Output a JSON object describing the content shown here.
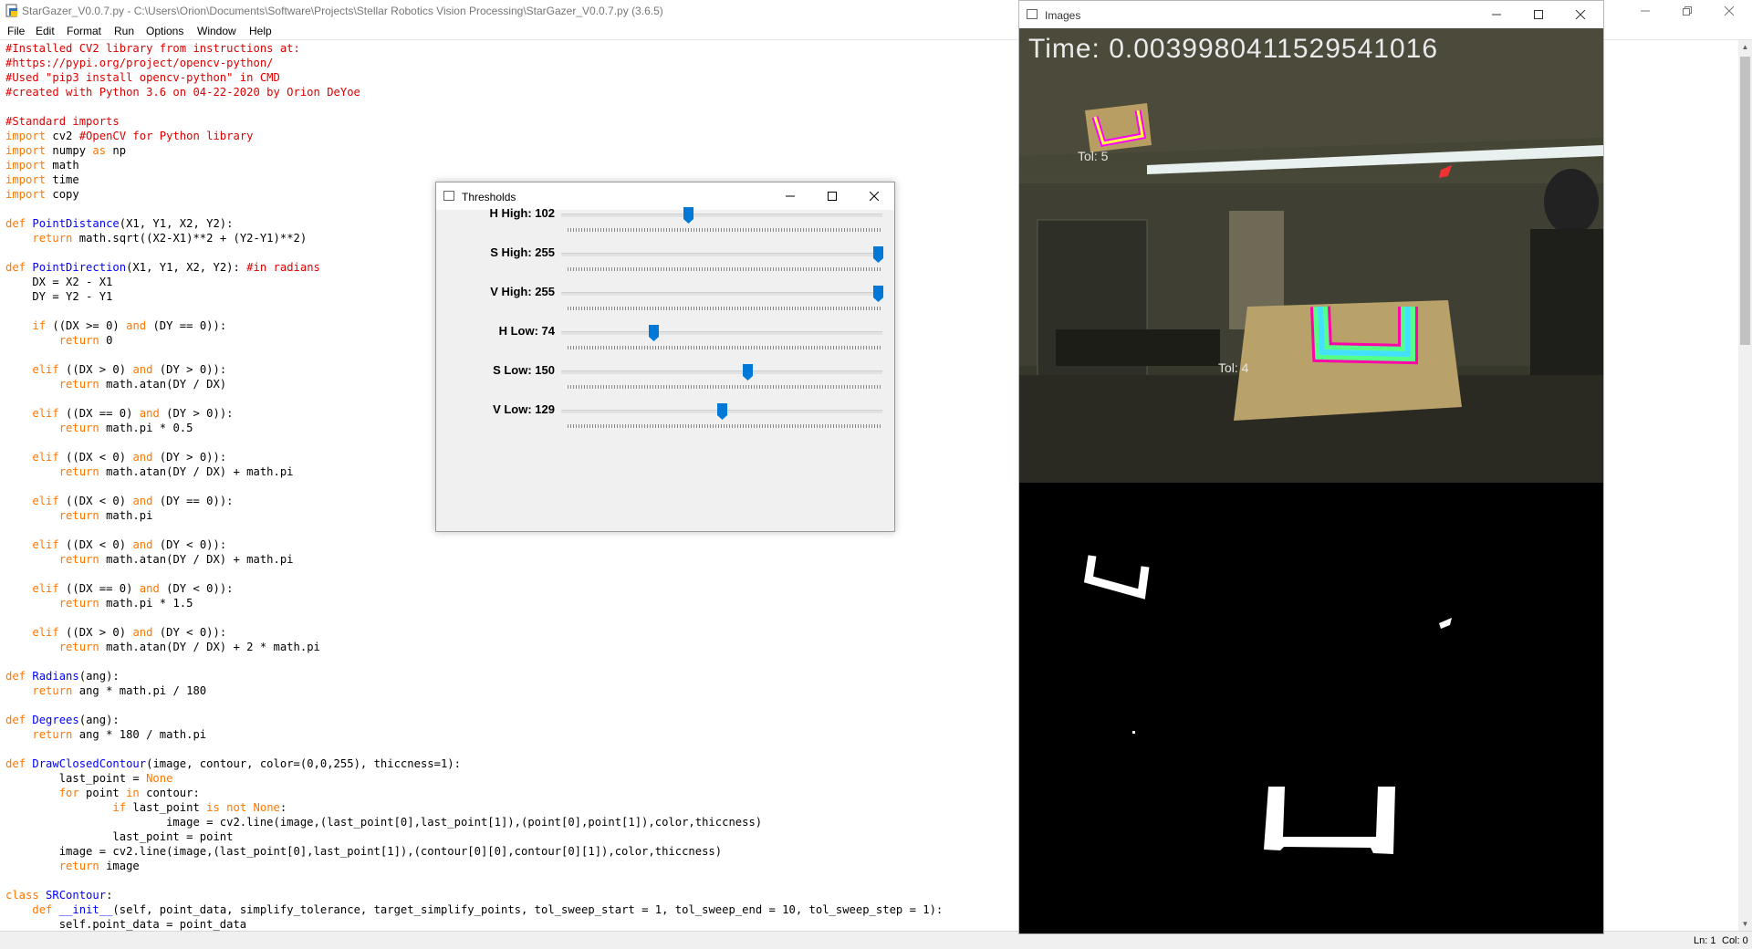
{
  "idle": {
    "title": "StarGazer_V0.0.7.py - C:\\Users\\Orion\\Documents\\Software\\Projects\\Stellar Robotics Vision Processing\\StarGazer_V0.0.7.py (3.6.5)",
    "menu": [
      "File",
      "Edit",
      "Format",
      "Run",
      "Options",
      "Window",
      "Help"
    ],
    "status": {
      "line": "Ln: 1",
      "col": "Col: 0"
    },
    "code": [
      [
        [
          "c",
          "#Installed CV2 library from instructions at:"
        ]
      ],
      [
        [
          "c",
          "#https://pypi.org/project/opencv-python/"
        ]
      ],
      [
        [
          "c",
          "#Used \"pip3 install opencv-python\" in CMD"
        ]
      ],
      [
        [
          "c",
          "#created with Python 3.6 on 04-22-2020 by Orion DeYoe"
        ]
      ],
      [],
      [
        [
          "c",
          "#Standard imports"
        ]
      ],
      [
        [
          "k",
          "import"
        ],
        [
          "t",
          " cv2 "
        ],
        [
          "c",
          "#OpenCV for Python library"
        ]
      ],
      [
        [
          "k",
          "import"
        ],
        [
          "t",
          " numpy "
        ],
        [
          "k",
          "as"
        ],
        [
          "t",
          " np"
        ]
      ],
      [
        [
          "k",
          "import"
        ],
        [
          "t",
          " math"
        ]
      ],
      [
        [
          "k",
          "import"
        ],
        [
          "t",
          " time"
        ]
      ],
      [
        [
          "k",
          "import"
        ],
        [
          "t",
          " copy"
        ]
      ],
      [],
      [
        [
          "k",
          "def"
        ],
        [
          "t",
          " "
        ],
        [
          "d",
          "PointDistance"
        ],
        [
          "t",
          "(X1, Y1, X2, Y2):"
        ]
      ],
      [
        [
          "t",
          "    "
        ],
        [
          "k",
          "return"
        ],
        [
          "t",
          " math.sqrt((X2-X1)**2 + (Y2-Y1)**2)"
        ]
      ],
      [],
      [
        [
          "k",
          "def"
        ],
        [
          "t",
          " "
        ],
        [
          "d",
          "PointDirection"
        ],
        [
          "t",
          "(X1, Y1, X2, Y2): "
        ],
        [
          "c",
          "#in radians"
        ]
      ],
      [
        [
          "t",
          "    DX = X2 - X1"
        ]
      ],
      [
        [
          "t",
          "    DY = Y2 - Y1"
        ]
      ],
      [],
      [
        [
          "t",
          "    "
        ],
        [
          "k",
          "if"
        ],
        [
          "t",
          " ((DX >= 0) "
        ],
        [
          "k",
          "and"
        ],
        [
          "t",
          " (DY == 0)):"
        ]
      ],
      [
        [
          "t",
          "        "
        ],
        [
          "k",
          "return"
        ],
        [
          "t",
          " 0"
        ]
      ],
      [],
      [
        [
          "t",
          "    "
        ],
        [
          "k",
          "elif"
        ],
        [
          "t",
          " ((DX > 0) "
        ],
        [
          "k",
          "and"
        ],
        [
          "t",
          " (DY > 0)):"
        ]
      ],
      [
        [
          "t",
          "        "
        ],
        [
          "k",
          "return"
        ],
        [
          "t",
          " math.atan(DY / DX)"
        ]
      ],
      [],
      [
        [
          "t",
          "    "
        ],
        [
          "k",
          "elif"
        ],
        [
          "t",
          " ((DX == 0) "
        ],
        [
          "k",
          "and"
        ],
        [
          "t",
          " (DY > 0)):"
        ]
      ],
      [
        [
          "t",
          "        "
        ],
        [
          "k",
          "return"
        ],
        [
          "t",
          " math.pi * 0.5"
        ]
      ],
      [],
      [
        [
          "t",
          "    "
        ],
        [
          "k",
          "elif"
        ],
        [
          "t",
          " ((DX < 0) "
        ],
        [
          "k",
          "and"
        ],
        [
          "t",
          " (DY > 0)):"
        ]
      ],
      [
        [
          "t",
          "        "
        ],
        [
          "k",
          "return"
        ],
        [
          "t",
          " math.atan(DY / DX) + math.pi"
        ]
      ],
      [],
      [
        [
          "t",
          "    "
        ],
        [
          "k",
          "elif"
        ],
        [
          "t",
          " ((DX < 0) "
        ],
        [
          "k",
          "and"
        ],
        [
          "t",
          " (DY == 0)):"
        ]
      ],
      [
        [
          "t",
          "        "
        ],
        [
          "k",
          "return"
        ],
        [
          "t",
          " math.pi"
        ]
      ],
      [],
      [
        [
          "t",
          "    "
        ],
        [
          "k",
          "elif"
        ],
        [
          "t",
          " ((DX < 0) "
        ],
        [
          "k",
          "and"
        ],
        [
          "t",
          " (DY < 0)):"
        ]
      ],
      [
        [
          "t",
          "        "
        ],
        [
          "k",
          "return"
        ],
        [
          "t",
          " math.atan(DY / DX) + math.pi"
        ]
      ],
      [],
      [
        [
          "t",
          "    "
        ],
        [
          "k",
          "elif"
        ],
        [
          "t",
          " ((DX == 0) "
        ],
        [
          "k",
          "and"
        ],
        [
          "t",
          " (DY < 0)):"
        ]
      ],
      [
        [
          "t",
          "        "
        ],
        [
          "k",
          "return"
        ],
        [
          "t",
          " math.pi * 1.5"
        ]
      ],
      [],
      [
        [
          "t",
          "    "
        ],
        [
          "k",
          "elif"
        ],
        [
          "t",
          " ((DX > 0) "
        ],
        [
          "k",
          "and"
        ],
        [
          "t",
          " (DY < 0)):"
        ]
      ],
      [
        [
          "t",
          "        "
        ],
        [
          "k",
          "return"
        ],
        [
          "t",
          " math.atan(DY / DX) + 2 * math.pi"
        ]
      ],
      [],
      [
        [
          "k",
          "def"
        ],
        [
          "t",
          " "
        ],
        [
          "d",
          "Radians"
        ],
        [
          "t",
          "(ang):"
        ]
      ],
      [
        [
          "t",
          "    "
        ],
        [
          "k",
          "return"
        ],
        [
          "t",
          " ang * math.pi / 180"
        ]
      ],
      [],
      [
        [
          "k",
          "def"
        ],
        [
          "t",
          " "
        ],
        [
          "d",
          "Degrees"
        ],
        [
          "t",
          "(ang):"
        ]
      ],
      [
        [
          "t",
          "    "
        ],
        [
          "k",
          "return"
        ],
        [
          "t",
          " ang * 180 / math.pi"
        ]
      ],
      [],
      [
        [
          "k",
          "def"
        ],
        [
          "t",
          " "
        ],
        [
          "d",
          "DrawClosedContour"
        ],
        [
          "t",
          "(image, contour, color=(0,0,255), thiccness=1):"
        ]
      ],
      [
        [
          "t",
          "        last_point = "
        ],
        [
          "k",
          "None"
        ]
      ],
      [
        [
          "t",
          "        "
        ],
        [
          "k",
          "for"
        ],
        [
          "t",
          " point "
        ],
        [
          "k",
          "in"
        ],
        [
          "t",
          " contour:"
        ]
      ],
      [
        [
          "t",
          "                "
        ],
        [
          "k",
          "if"
        ],
        [
          "t",
          " last_point "
        ],
        [
          "k",
          "is not None"
        ],
        [
          "t",
          ":"
        ]
      ],
      [
        [
          "t",
          "                        image = cv2.line(image,(last_point[0],last_point[1]),(point[0],point[1]),color,thiccness)"
        ]
      ],
      [
        [
          "t",
          "                last_point = point"
        ]
      ],
      [
        [
          "t",
          "        image = cv2.line(image,(last_point[0],last_point[1]),(contour[0][0],contour[0][1]),color,thiccness)"
        ]
      ],
      [
        [
          "t",
          "        "
        ],
        [
          "k",
          "return"
        ],
        [
          "t",
          " image"
        ]
      ],
      [],
      [
        [
          "k",
          "class"
        ],
        [
          "t",
          " "
        ],
        [
          "d",
          "SRContour"
        ],
        [
          "t",
          ":"
        ]
      ],
      [
        [
          "t",
          "    "
        ],
        [
          "k",
          "def"
        ],
        [
          "t",
          " "
        ],
        [
          "d",
          "__init__"
        ],
        [
          "t",
          "(self, point_data, simplify_tolerance, target_simplify_points, tol_sweep_start = 1, tol_sweep_end = 10, tol_sweep_step = 1):"
        ]
      ],
      [
        [
          "t",
          "        self.point_data = point_data"
        ]
      ]
    ]
  },
  "images": {
    "title": "Images",
    "time_label": "Time: 0.0039980411529541016",
    "tol_labels": [
      "Tol: 5",
      "Tol: 4"
    ]
  },
  "thresholds": {
    "title": "Thresholds",
    "max": 255,
    "sliders": [
      {
        "label": "H High: 102",
        "value": 102
      },
      {
        "label": "S High: 255",
        "value": 255
      },
      {
        "label": "V High: 255",
        "value": 255
      },
      {
        "label": "H Low: 74",
        "value": 74
      },
      {
        "label": "S Low: 150",
        "value": 150
      },
      {
        "label": "V Low: 129",
        "value": 129
      }
    ]
  },
  "icons": {
    "minimize": "minimize-icon",
    "maximize": "maximize-icon",
    "close": "close-icon",
    "restore": "restore-icon"
  }
}
